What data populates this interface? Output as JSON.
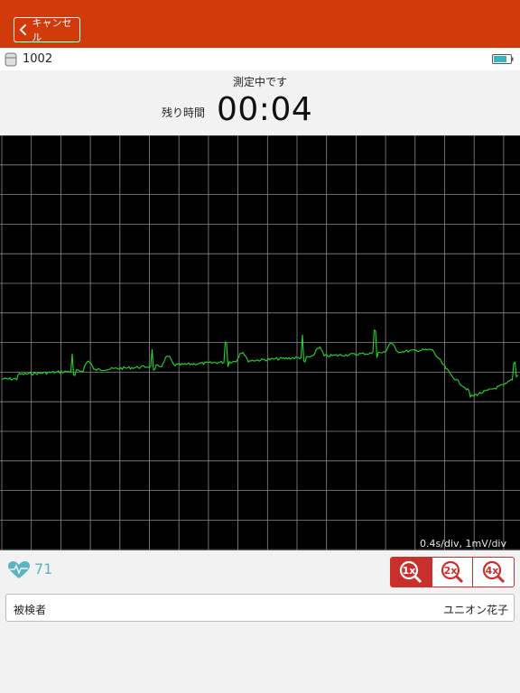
{
  "header": {
    "cancel_label": "キャンセル"
  },
  "device": {
    "id": "1002"
  },
  "measurement": {
    "status": "測定中です",
    "remaining_label": "残り時間",
    "remaining_value": "00:04",
    "scale": "0.4s/div, 1mV/div"
  },
  "heart_rate": {
    "value": "71"
  },
  "zoom": {
    "options": [
      "1x",
      "2x",
      "4x"
    ],
    "selected": "1x"
  },
  "subject": {
    "label": "被検者",
    "value": "ユニオン花子"
  },
  "colors": {
    "header": "#d13a0a",
    "ecg_trace": "#22d82a",
    "grid": "#8a8a8a",
    "zoom_accent": "#c9302c",
    "heart_rate": "#5bb3c1"
  }
}
